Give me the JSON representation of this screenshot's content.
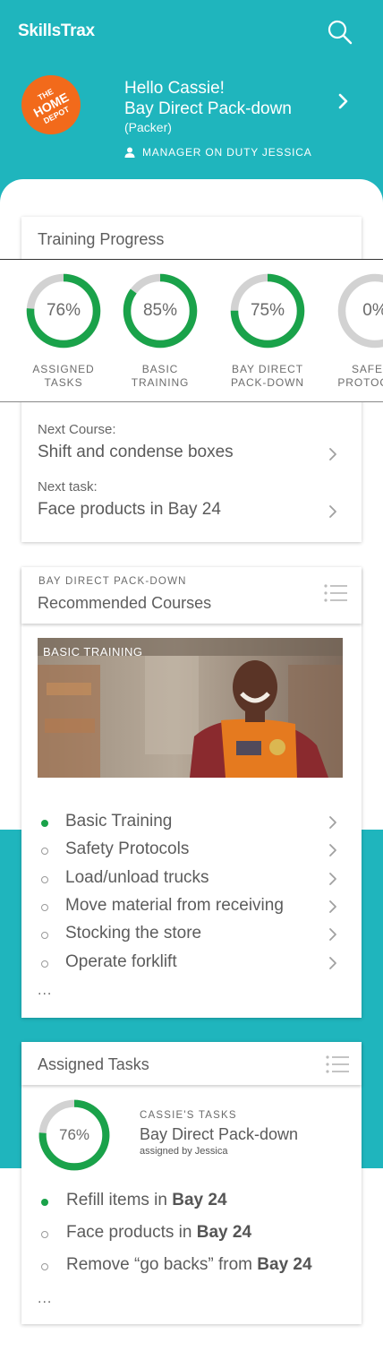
{
  "app": {
    "brand": "SkillsTrax"
  },
  "header": {
    "logo_text": [
      "THE",
      "HOME",
      "DEPOT"
    ],
    "greeting": "Hello Cassie!",
    "job_title": "Bay Direct Pack-down",
    "role": "(Packer)",
    "manager": "MANAGER ON DUTY JESSICA"
  },
  "training_progress": {
    "title": "Training Progress",
    "rings": [
      {
        "value_text": "76%",
        "value": 76,
        "label_line1": "ASSIGNED",
        "label_line2": "TASKS"
      },
      {
        "value_text": "85%",
        "value": 85,
        "label_line1": "BASIC",
        "label_line2": "TRAINING"
      },
      {
        "value_text": "75%",
        "value": 75,
        "label_line1": "BAY DIRECT",
        "label_line2": "PACK-DOWN"
      },
      {
        "value_text": "0%",
        "value": 0,
        "label_line1": "SAFETY",
        "label_line2": "PROTOCOLS"
      }
    ],
    "next_course_label": "Next Course:",
    "next_course": "Shift and condense boxes",
    "next_task_label": "Next task:",
    "next_task": "Face products in Bay 24"
  },
  "recommended": {
    "kicker": "BAY DIRECT PACK-DOWN",
    "title": "Recommended Courses",
    "hero_label": "BASIC TRAINING",
    "courses": [
      {
        "label": "Basic Training",
        "done": true
      },
      {
        "label": "Safety Protocols",
        "done": false
      },
      {
        "label": "Load/unload trucks",
        "done": false
      },
      {
        "label": "Move material from receiving",
        "done": false
      },
      {
        "label": "Stocking the store",
        "done": false
      },
      {
        "label": "Operate forklift",
        "done": false
      }
    ],
    "more": "..."
  },
  "assigned": {
    "title": "Assigned Tasks",
    "ring_value_text": "76%",
    "ring_value": 76,
    "kicker": "CASSIE'S TASKS",
    "task_group": "Bay Direct Pack-down",
    "assigned_by": "assigned by Jessica",
    "tasks": [
      {
        "prefix": "Refill items in ",
        "bold": "Bay 24",
        "done": true
      },
      {
        "prefix": "Face products in ",
        "bold": "Bay 24",
        "done": false
      },
      {
        "prefix": "Remove “go backs” from ",
        "bold": "Bay 24",
        "done": false
      }
    ],
    "more": "..."
  },
  "colors": {
    "teal": "#1fb5bd",
    "green": "#1aa24a",
    "ring_track": "#d2d2d2",
    "orange": "#f26a1b"
  }
}
